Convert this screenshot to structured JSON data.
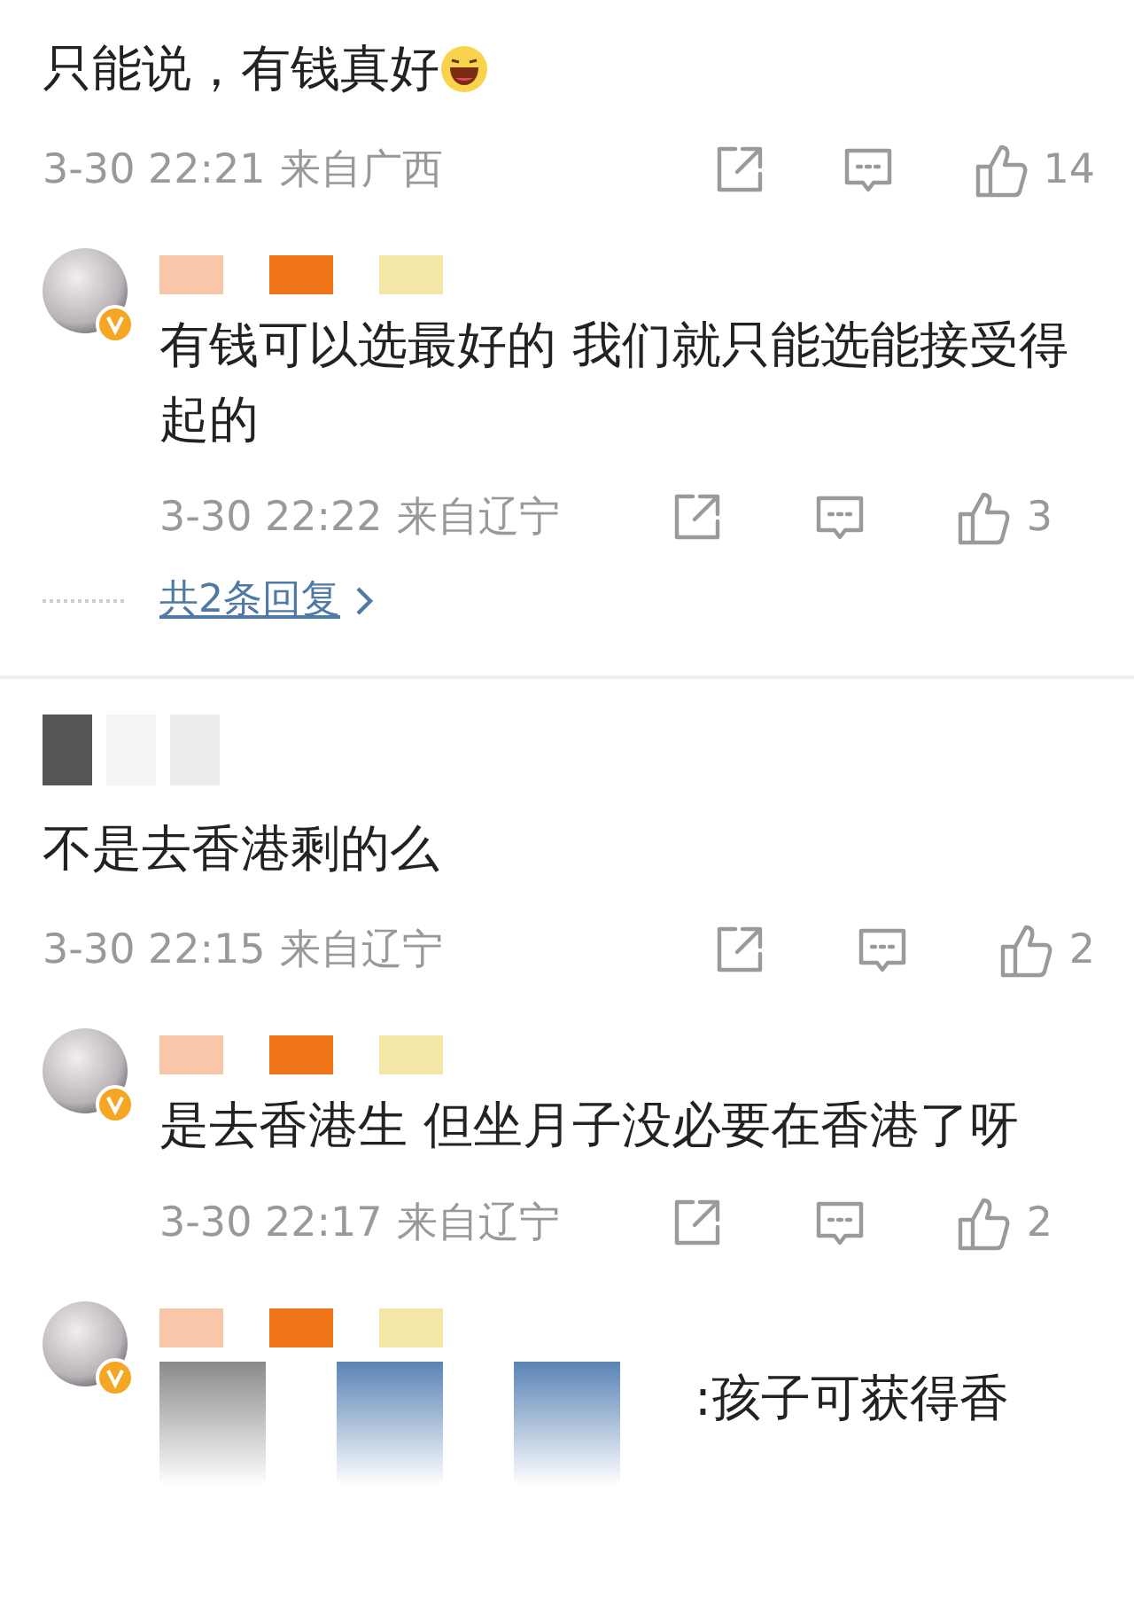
{
  "threads": [
    {
      "comment": {
        "text": "只能说，有钱真好",
        "emoji": true,
        "time": "3-30 22:21",
        "location": "来自广西",
        "likes": "14"
      },
      "replies": [
        {
          "verified": true,
          "text": "有钱可以选最好的 我们就只能选能接受得起的",
          "time": "3-30 22:22",
          "location": "来自辽宁",
          "likes": "3"
        }
      ],
      "more_replies": "共2条回复"
    },
    {
      "comment": {
        "text": "不是去香港剩的么",
        "emoji": false,
        "time": "3-30 22:15",
        "location": "来自辽宁",
        "likes": "2"
      },
      "replies": [
        {
          "verified": true,
          "text": "是去香港生 但坐月子没必要在香港了呀",
          "time": "3-30 22:17",
          "location": "来自辽宁",
          "likes": "2"
        },
        {
          "verified": true,
          "text": ":孩子可获得香"
        }
      ]
    }
  ]
}
